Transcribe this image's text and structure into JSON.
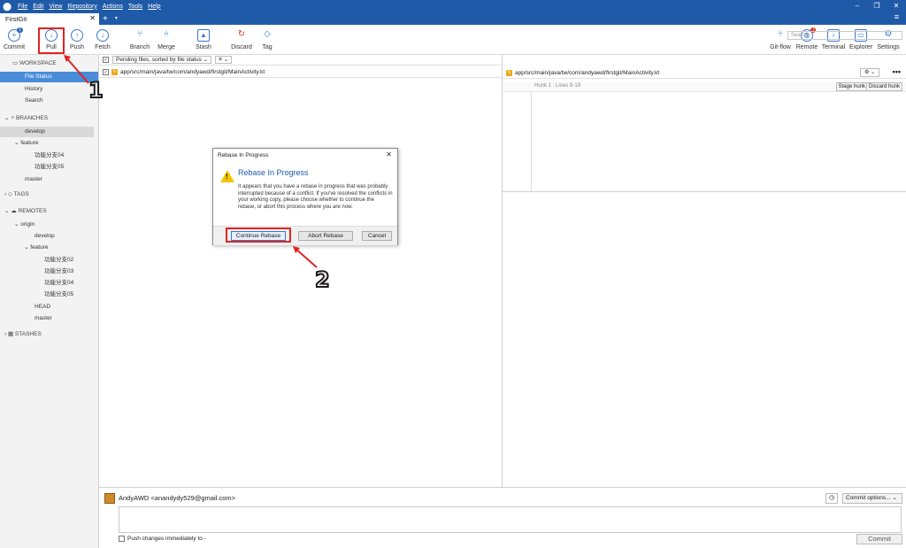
{
  "menu": [
    "File",
    "Edit",
    "View",
    "Repository",
    "Actions",
    "Tools",
    "Help"
  ],
  "window_controls": {
    "minimize": "–",
    "maximize": "❐",
    "close": "✕"
  },
  "tabs": {
    "active": "FirstGit",
    "close": "✕",
    "add": "+",
    "dropdown": "▾",
    "menu": "≡"
  },
  "toolbar": {
    "commit": "Commit",
    "commit_badge": "1",
    "pull": "Pull",
    "push": "Push",
    "fetch": "Fetch",
    "branch": "Branch",
    "merge": "Merge",
    "stash": "Stash",
    "discard": "Discard",
    "tag": "Tag",
    "gitflow": "Git-flow",
    "remote": "Remote",
    "remote_badge": "!",
    "terminal": "Terminal",
    "explorer": "Explorer",
    "settings": "Settings"
  },
  "search": {
    "placeholder": "Search"
  },
  "sidebar": {
    "workspace": "WORKSPACE",
    "file_status": "File Status",
    "history": "History",
    "search": "Search",
    "branches": "BRANCHES",
    "develop": "develop",
    "feature": "feature",
    "feature_04": "功能分支04",
    "feature_05": "功能分支05",
    "master": "master",
    "tags": "TAGS",
    "remotes": "REMOTES",
    "origin": "origin",
    "r_develop": "develop",
    "r_feature": "feature",
    "r_feature_02": "功能分支02",
    "r_feature_03": "功能分支03",
    "r_feature_04": "功能分支04",
    "r_feature_05": "功能分支05",
    "head": "HEAD",
    "r_master": "master",
    "stashes": "STASHES"
  },
  "center": {
    "filter": "Pending files, sorted by file status",
    "view_toggle": "≡",
    "file_path": "app/src/main/java/tw/com/andyawd/firstgit/MainActivity.kt"
  },
  "right": {
    "file_path": "app/src/main/java/tw/com/andyawd/firstgit/MainActivity.kt",
    "hunk": "Hunk 1 : Lines 8-19",
    "stage_hunk": "Stage hunk",
    "discard_hunk": "Discard hunk"
  },
  "commit": {
    "author": "AndyAWD <anandydy529@gmail.com>",
    "options": "Commit options...",
    "push_label": "Push changes immediately to -",
    "commit_button": "Commit"
  },
  "dialog": {
    "title": "Rebase In Progress",
    "heading": "Rebase In Progress",
    "body": "It appears that you have a rebase in progress that was probably interrupted because of a conflict. If you've resolved the conflicts in your working copy, please choose whether to continue the rebase, or abort this process where you are now.",
    "continue": "Continue Rebase",
    "abort": "Abort Rebase",
    "cancel": "Cancel"
  },
  "annotations": {
    "one": "1",
    "two": "2"
  },
  "colors": {
    "titlebar": "#1e5aa8",
    "selection": "#4a8cd8",
    "annotation": "#e02424"
  }
}
